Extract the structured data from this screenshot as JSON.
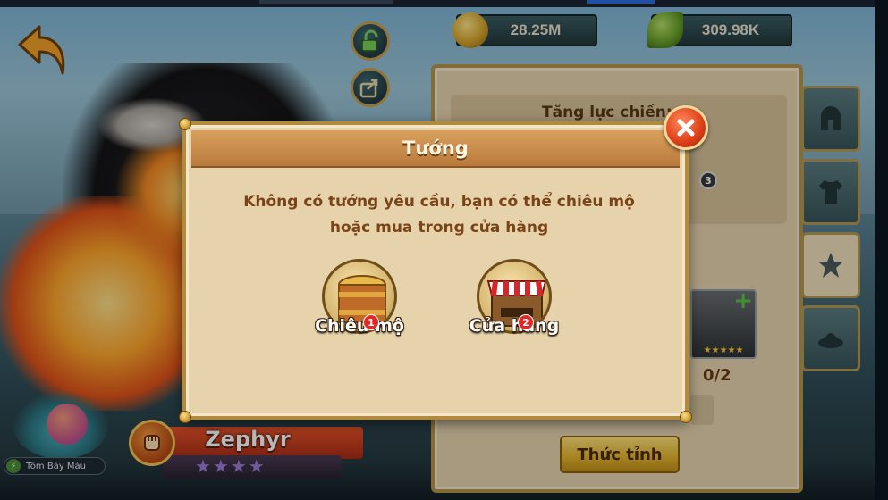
{
  "currency": {
    "gold": "28.25M",
    "leaf": "309.98K"
  },
  "panel": {
    "power_label": "Tăng lực chiến:",
    "card_count": "0/2",
    "awaken_label": "Thức tỉnh",
    "card_stars": "★★★★★",
    "card_level": "3"
  },
  "hero": {
    "name": "Zephyr",
    "stars": "★★★★"
  },
  "pet": {
    "label": "Tôm Bảy Màu"
  },
  "modal": {
    "title": "Tướng",
    "message": "Không có tướng yêu cầu, bạn có thể chiêu mộ hoặc mua trong cửa hàng",
    "options": [
      {
        "label": "Chiêu mộ",
        "badge": "1"
      },
      {
        "label": "Cửa hàng",
        "badge": "2"
      }
    ]
  },
  "colors": {
    "modal_bg": "#e6d3ac",
    "modal_header": "#c98e4c",
    "message_text": "#7a4418",
    "close_red": "#e0431b",
    "badge_red": "#e32626"
  }
}
